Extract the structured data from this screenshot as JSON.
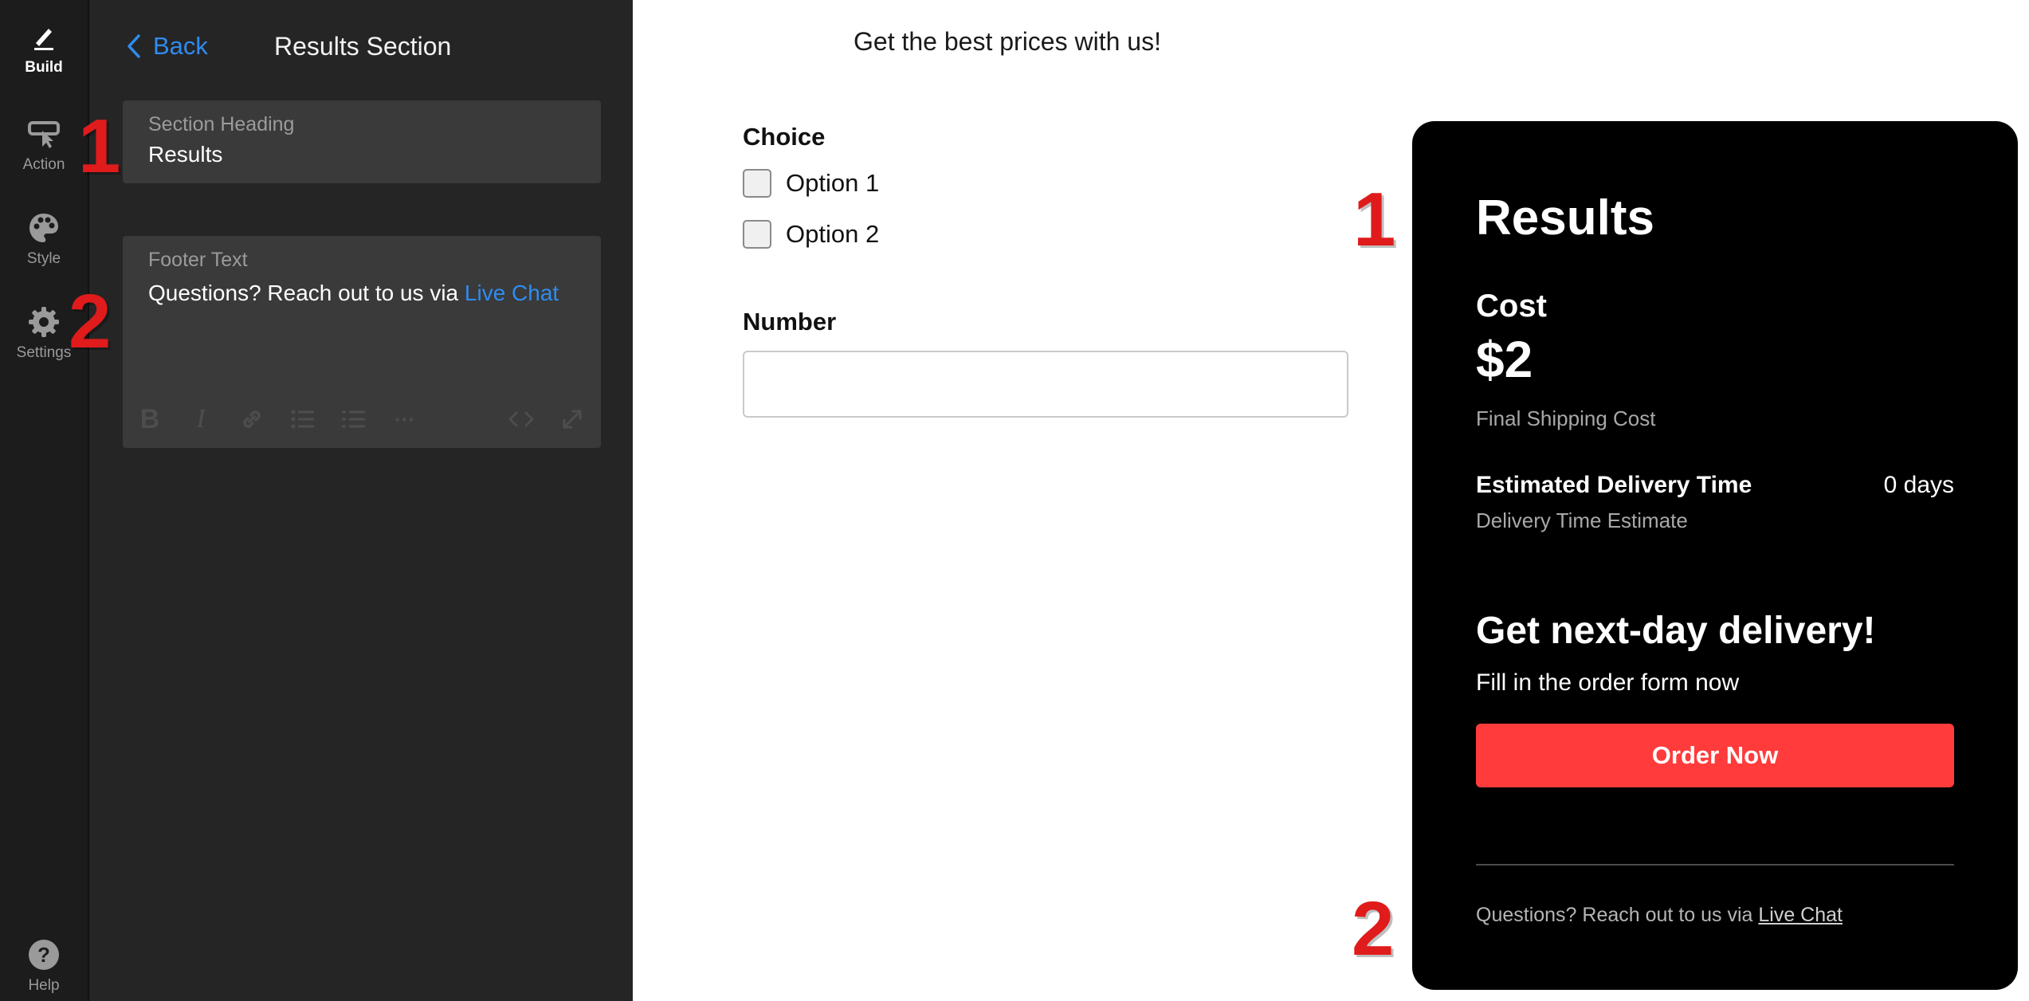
{
  "rail": {
    "items": [
      {
        "label": "Build",
        "icon": "pencil-icon",
        "active": true
      },
      {
        "label": "Action",
        "icon": "cursor-icon"
      },
      {
        "label": "Style",
        "icon": "palette-icon"
      },
      {
        "label": "Settings",
        "icon": "gear-icon"
      }
    ],
    "help": {
      "label": "Help",
      "icon": "help-icon",
      "glyph": "?"
    }
  },
  "panel": {
    "back_label": "Back",
    "title": "Results Section",
    "section_heading": {
      "label": "Section Heading",
      "value": "Results"
    },
    "footer_text": {
      "label": "Footer Text",
      "text": "Questions? Reach out to us via ",
      "link": "Live Chat"
    },
    "toolbar": [
      "bold-icon",
      "italic-icon",
      "link-icon",
      "bulleted-list-icon",
      "numbered-list-icon",
      "more-icon",
      "code-icon",
      "expand-icon"
    ],
    "toolbar_glyphs": {
      "bold": "B",
      "italic": "I",
      "more": "···"
    }
  },
  "annotations": {
    "one": "1",
    "two": "2"
  },
  "preview": {
    "tagline": "Get the best prices with us!",
    "choice": {
      "label": "Choice",
      "options": [
        "Option 1",
        "Option 2"
      ]
    },
    "number": {
      "label": "Number",
      "value": ""
    },
    "results": {
      "title": "Results",
      "cost_label": "Cost",
      "cost_value": "$2",
      "cost_sub": "Final Shipping Cost",
      "delivery_label": "Estimated Delivery Time",
      "delivery_value": "0 days",
      "delivery_sub": "Delivery Time Estimate",
      "promo_title": "Get next-day delivery!",
      "promo_sub": "Fill in the order form now",
      "order_button": "Order Now",
      "footer_text": "Questions? Reach out to us via ",
      "footer_link": "Live Chat"
    }
  },
  "colors": {
    "accent": "#2f8cf0",
    "order_button": "#ff3b3b",
    "annotation": "#e01b1b"
  }
}
